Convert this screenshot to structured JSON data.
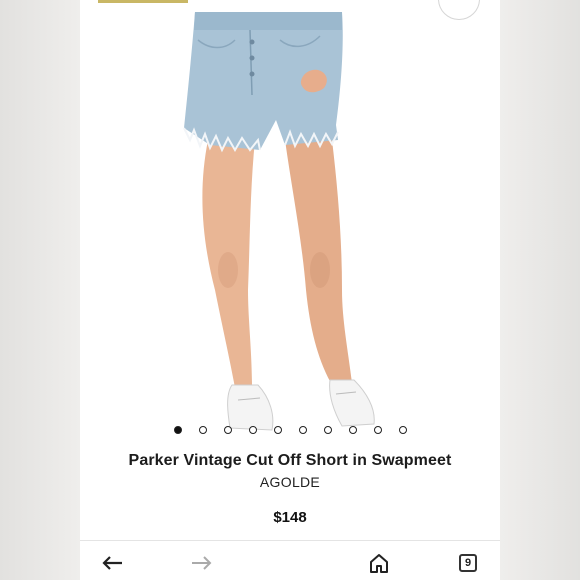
{
  "product": {
    "title": "Parker Vintage Cut Off Short in Swapmeet",
    "brand": "AGOLDE",
    "price": "$148"
  },
  "carousel": {
    "total": 10,
    "active_index": 0
  },
  "bottom_nav": {
    "back_icon": "arrow-left-icon",
    "forward_icon": "arrow-right-icon",
    "home_icon": "home-icon",
    "tabs_count": "9"
  },
  "colors": {
    "accent": "#c9b765",
    "denim": "#a9c3d6",
    "text": "#1c1c1c"
  }
}
